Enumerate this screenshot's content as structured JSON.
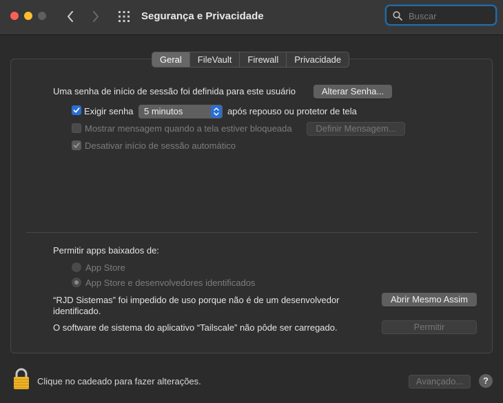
{
  "window": {
    "title": "Segurança e Privacidade",
    "search_placeholder": "Buscar"
  },
  "tabs": [
    {
      "label": "Geral",
      "active": true
    },
    {
      "label": "FileVault",
      "active": false
    },
    {
      "label": "Firewall",
      "active": false
    },
    {
      "label": "Privacidade",
      "active": false
    }
  ],
  "general": {
    "password_set_text": "Uma senha de início de sessão foi definida para este usuário",
    "change_password_button": "Alterar Senha...",
    "require_password": {
      "label": "Exigir senha",
      "checked": true
    },
    "require_delay": "5 minutos",
    "after_sleep_text": "após repouso ou protetor de tela",
    "show_message": {
      "label": "Mostrar mensagem quando a tela estiver bloqueada",
      "checked": false
    },
    "set_message_button": "Definir Mensagem...",
    "disable_autologin": {
      "label": "Desativar início de sessão automático",
      "checked": true
    }
  },
  "downloads": {
    "heading": "Permitir apps baixados de:",
    "options": [
      {
        "label": "App Store",
        "selected": false
      },
      {
        "label": "App Store e desenvolvedores identificados",
        "selected": true
      }
    ],
    "blocked_text_line1": "“RJD Sistemas” foi impedido de uso porque não é de um desenvolvedor",
    "blocked_text_line2": "identificado.",
    "open_anyway_button": "Abrir Mesmo Assim",
    "software_text": "O software de sistema do aplicativo “Tailscale” não pôde ser carregado.",
    "allow_button": "Permitir"
  },
  "footer": {
    "lock_text": "Clique no cadeado para fazer alterações.",
    "advanced_button": "Avançado...",
    "help_label": "?"
  },
  "colors": {
    "accent": "#2a6ed4",
    "lock": "#f0b429"
  }
}
